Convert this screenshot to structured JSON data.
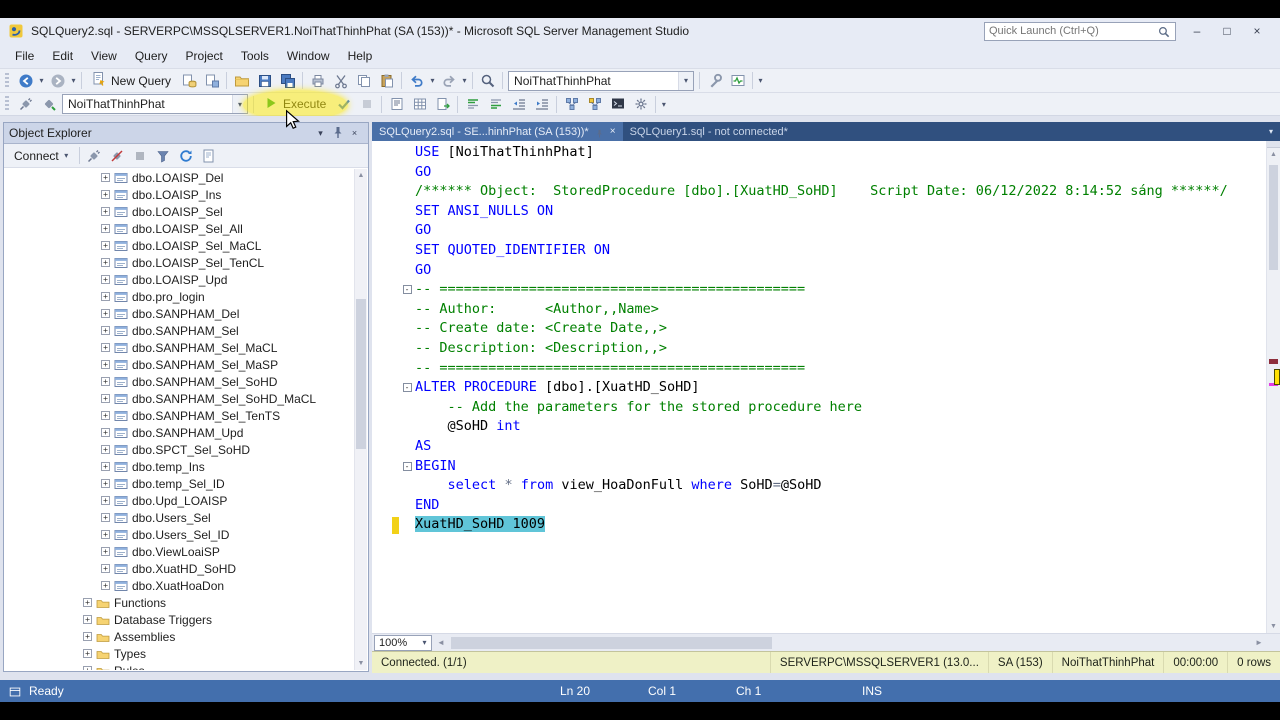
{
  "window": {
    "title": "SQLQuery2.sql - SERVERPC\\MSSQLSERVER1.NoiThatThinhPhat (SA (153))* - Microsoft SQL Server Management Studio",
    "quick_launch_placeholder": "Quick Launch (Ctrl+Q)",
    "controls": [
      "minimize",
      "maximize",
      "close"
    ]
  },
  "menu": [
    "File",
    "Edit",
    "View",
    "Query",
    "Project",
    "Tools",
    "Window",
    "Help"
  ],
  "toolbar_main": {
    "items": [
      "nav-back",
      "nav-forward",
      "sep",
      "new-query",
      "database-engine-query",
      "analysis-query",
      "sep",
      "open-file",
      "save",
      "save-all",
      "sep",
      "print",
      "cut",
      "copy",
      "paste",
      "sep",
      "undo",
      "redo",
      "sep",
      "find",
      "sep",
      "database-combo",
      "sep",
      "wrench",
      "activity-monitor",
      "sep",
      "overflow-chevron"
    ],
    "new_query_label": "New Query",
    "database_combo": "NoiThatThinhPhat"
  },
  "toolbar_query": {
    "items": [
      "connection",
      "change-connection",
      "database-combo",
      "sep",
      "execute-button",
      "parse-check",
      "cancel-query",
      "sep",
      "results-to-text",
      "results-to-grid",
      "results-to-file",
      "sep",
      "comment",
      "uncomment",
      "indent-decrease",
      "indent-increase",
      "sep",
      "estimated-plan",
      "actual-plan",
      "sqlcmd",
      "query-options",
      "sep",
      "overflow-chevron"
    ],
    "execute_label": "Execute",
    "database_combo": "NoiThatThinhPhat"
  },
  "object_explorer": {
    "title": "Object Explorer",
    "connect_label": "Connect",
    "toolbar_icons": [
      "connect-plug",
      "disconnect-plug",
      "stop",
      "filter",
      "refresh",
      "script"
    ],
    "tree": [
      {
        "label": "dbo.LOAISP_Del",
        "type": "proc"
      },
      {
        "label": "dbo.LOAISP_Ins",
        "type": "proc"
      },
      {
        "label": "dbo.LOAISP_Sel",
        "type": "proc"
      },
      {
        "label": "dbo.LOAISP_Sel_All",
        "type": "proc"
      },
      {
        "label": "dbo.LOAISP_Sel_MaCL",
        "type": "proc"
      },
      {
        "label": "dbo.LOAISP_Sel_TenCL",
        "type": "proc"
      },
      {
        "label": "dbo.LOAISP_Upd",
        "type": "proc"
      },
      {
        "label": "dbo.pro_login",
        "type": "proc"
      },
      {
        "label": "dbo.SANPHAM_Del",
        "type": "proc"
      },
      {
        "label": "dbo.SANPHAM_Sel",
        "type": "proc"
      },
      {
        "label": "dbo.SANPHAM_Sel_MaCL",
        "type": "proc"
      },
      {
        "label": "dbo.SANPHAM_Sel_MaSP",
        "type": "proc"
      },
      {
        "label": "dbo.SANPHAM_Sel_SoHD",
        "type": "proc"
      },
      {
        "label": "dbo.SANPHAM_Sel_SoHD_MaCL",
        "type": "proc"
      },
      {
        "label": "dbo.SANPHAM_Sel_TenTS",
        "type": "proc"
      },
      {
        "label": "dbo.SANPHAM_Upd",
        "type": "proc"
      },
      {
        "label": "dbo.SPCT_Sel_SoHD",
        "type": "proc"
      },
      {
        "label": "dbo.temp_Ins",
        "type": "proc"
      },
      {
        "label": "dbo.temp_Sel_ID",
        "type": "proc"
      },
      {
        "label": "dbo.Upd_LOAISP",
        "type": "proc"
      },
      {
        "label": "dbo.Users_Sel",
        "type": "proc"
      },
      {
        "label": "dbo.Users_Sel_ID",
        "type": "proc"
      },
      {
        "label": "dbo.ViewLoaiSP",
        "type": "proc"
      },
      {
        "label": "dbo.XuatHD_SoHD",
        "type": "proc"
      },
      {
        "label": "dbo.XuatHoaDon",
        "type": "proc"
      },
      {
        "label": "Functions",
        "type": "folder"
      },
      {
        "label": "Database Triggers",
        "type": "folder"
      },
      {
        "label": "Assemblies",
        "type": "folder"
      },
      {
        "label": "Types",
        "type": "folder"
      },
      {
        "label": "Rules",
        "type": "folder"
      }
    ]
  },
  "tabs": [
    {
      "label": "SQLQuery2.sql - SE...hinhPhat (SA (153))*",
      "active": true
    },
    {
      "label": "SQLQuery1.sql - not connected*",
      "active": false
    }
  ],
  "editor": {
    "zoom": "100%",
    "lines": [
      {
        "segs": [
          {
            "t": "USE",
            "c": "k"
          },
          {
            "t": " [NoiThatThinhPhat]",
            "c": "p"
          }
        ]
      },
      {
        "segs": [
          {
            "t": "GO",
            "c": "k"
          }
        ]
      },
      {
        "segs": [
          {
            "t": "/****** Object:  StoredProcedure [dbo].[XuatHD_SoHD]    Script Date: 06/12/2022 8:14:52 sáng ******/",
            "c": "c"
          }
        ]
      },
      {
        "segs": [
          {
            "t": "SET ANSI_NULLS ON",
            "c": "k"
          }
        ]
      },
      {
        "segs": [
          {
            "t": "GO",
            "c": "k"
          }
        ]
      },
      {
        "segs": [
          {
            "t": "SET QUOTED_IDENTIFIER ON",
            "c": "k"
          }
        ]
      },
      {
        "segs": [
          {
            "t": "GO",
            "c": "k"
          }
        ]
      },
      {
        "fold": true,
        "segs": [
          {
            "t": "-- =============================================",
            "c": "c"
          }
        ]
      },
      {
        "segs": [
          {
            "t": "-- Author:      <Author,,Name>",
            "c": "c"
          }
        ]
      },
      {
        "segs": [
          {
            "t": "-- Create date: <Create Date,,>",
            "c": "c"
          }
        ]
      },
      {
        "segs": [
          {
            "t": "-- Description: <Description,,>",
            "c": "c"
          }
        ]
      },
      {
        "segs": [
          {
            "t": "-- =============================================",
            "c": "c"
          }
        ]
      },
      {
        "fold": true,
        "segs": [
          {
            "t": "ALTER PROCEDURE",
            "c": "k"
          },
          {
            "t": " [dbo].[XuatHD_SoHD]",
            "c": "p"
          }
        ]
      },
      {
        "segs": [
          {
            "t": "    -- Add the parameters for the stored procedure here",
            "c": "c"
          }
        ]
      },
      {
        "segs": [
          {
            "t": "    @SoHD ",
            "c": "p"
          },
          {
            "t": "int",
            "c": "k"
          }
        ]
      },
      {
        "segs": [
          {
            "t": "AS",
            "c": "k"
          }
        ]
      },
      {
        "fold": true,
        "segs": [
          {
            "t": "BEGIN",
            "c": "k"
          }
        ]
      },
      {
        "segs": [
          {
            "t": "    ",
            "c": "p"
          },
          {
            "t": "select",
            "c": "k"
          },
          {
            "t": " ",
            "c": "p"
          },
          {
            "t": "*",
            "c": "o"
          },
          {
            "t": " ",
            "c": "p"
          },
          {
            "t": "from",
            "c": "k"
          },
          {
            "t": " view_HoaDonFull ",
            "c": "p"
          },
          {
            "t": "where",
            "c": "k"
          },
          {
            "t": " SoHD",
            "c": "p"
          },
          {
            "t": "=",
            "c": "o"
          },
          {
            "t": "@SoHD",
            "c": "p"
          }
        ]
      },
      {
        "segs": [
          {
            "t": "END",
            "c": "k"
          }
        ]
      },
      {
        "changed": true,
        "selected": true,
        "segs": [
          {
            "t": "XuatHD_SoHD 1009",
            "c": "p"
          }
        ]
      }
    ]
  },
  "editor_status": {
    "connected": "Connected. (1/1)",
    "server": "SERVERPC\\MSSQLSERVER1 (13.0...",
    "user": "SA (153)",
    "database": "NoiThatThinhPhat",
    "time": "00:00:00",
    "rows": "0 rows"
  },
  "status_bar": {
    "ready": "Ready",
    "line": "Ln 20",
    "column": "Col 1",
    "char": "Ch 1",
    "mode": "INS"
  },
  "colors": {
    "keyword": "#0000ff",
    "comment": "#008000",
    "operator": "#616c84",
    "selection": "#60c5d8",
    "modified_line": "#f2d117",
    "status_bar": "#436fad"
  }
}
